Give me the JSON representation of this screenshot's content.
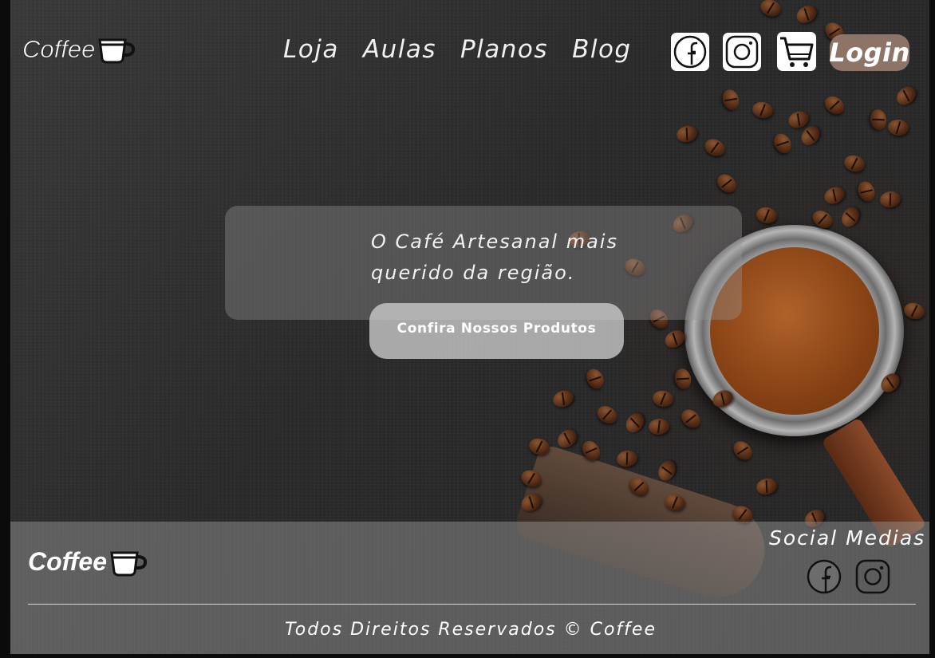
{
  "header": {
    "logo_text": "Coffee",
    "nav_items": [
      "Loja",
      "Aulas",
      "Planos",
      "Blog"
    ],
    "icons": [
      "facebook-icon",
      "instagram-icon",
      "cart-icon"
    ],
    "login_label": "Login"
  },
  "hero": {
    "tagline_line1": "O Café Artesanal mais",
    "tagline_line2": "querido da região.",
    "cta_label": "Confira Nossos Produtos"
  },
  "footer": {
    "logo_text": "Coffee",
    "social_title": "Social Medias",
    "social_icons": [
      "facebook-icon",
      "instagram-icon"
    ],
    "copyright": "Todos Direitos Reservados © Coffee"
  },
  "colors": {
    "login_bg": "#8e7466",
    "background": "#2b2b2b",
    "footer_overlay": "rgba(150,150,150,0.48)"
  }
}
